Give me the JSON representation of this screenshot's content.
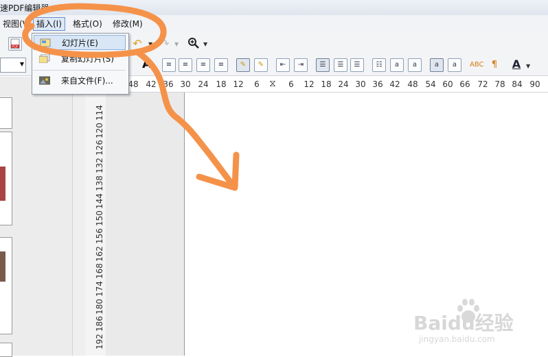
{
  "window": {
    "title": "速PDF编辑器"
  },
  "menubar": {
    "items": [
      {
        "label": "视图(V)"
      },
      {
        "label": "插入(I)"
      },
      {
        "label": "格式(O)"
      },
      {
        "label": "修改(M)"
      }
    ]
  },
  "dropdown": {
    "items": [
      {
        "label": "幻灯片(E)"
      },
      {
        "label": "复制幻灯片(S)"
      },
      {
        "label": "来自文件(F)..."
      }
    ]
  },
  "ruler": {
    "ticks": [
      "48",
      "42",
      "36",
      "30",
      "24",
      "18",
      "12",
      "6",
      "6",
      "12",
      "18",
      "24",
      "30",
      "36",
      "42",
      "48",
      "54",
      "60",
      "66",
      "72",
      "78",
      "84",
      "90"
    ]
  },
  "vruler": {
    "ticks": [
      "114",
      "120",
      "126",
      "132",
      "138",
      "144",
      "150",
      "156",
      "162",
      "168",
      "174",
      "180",
      "186",
      "192"
    ]
  },
  "watermark": {
    "brand": "Baidu经验",
    "url": "jingyan.baidu.com"
  },
  "colors": {
    "annotation": "#F5924A",
    "menu_highlight": "#DCE8F7"
  }
}
